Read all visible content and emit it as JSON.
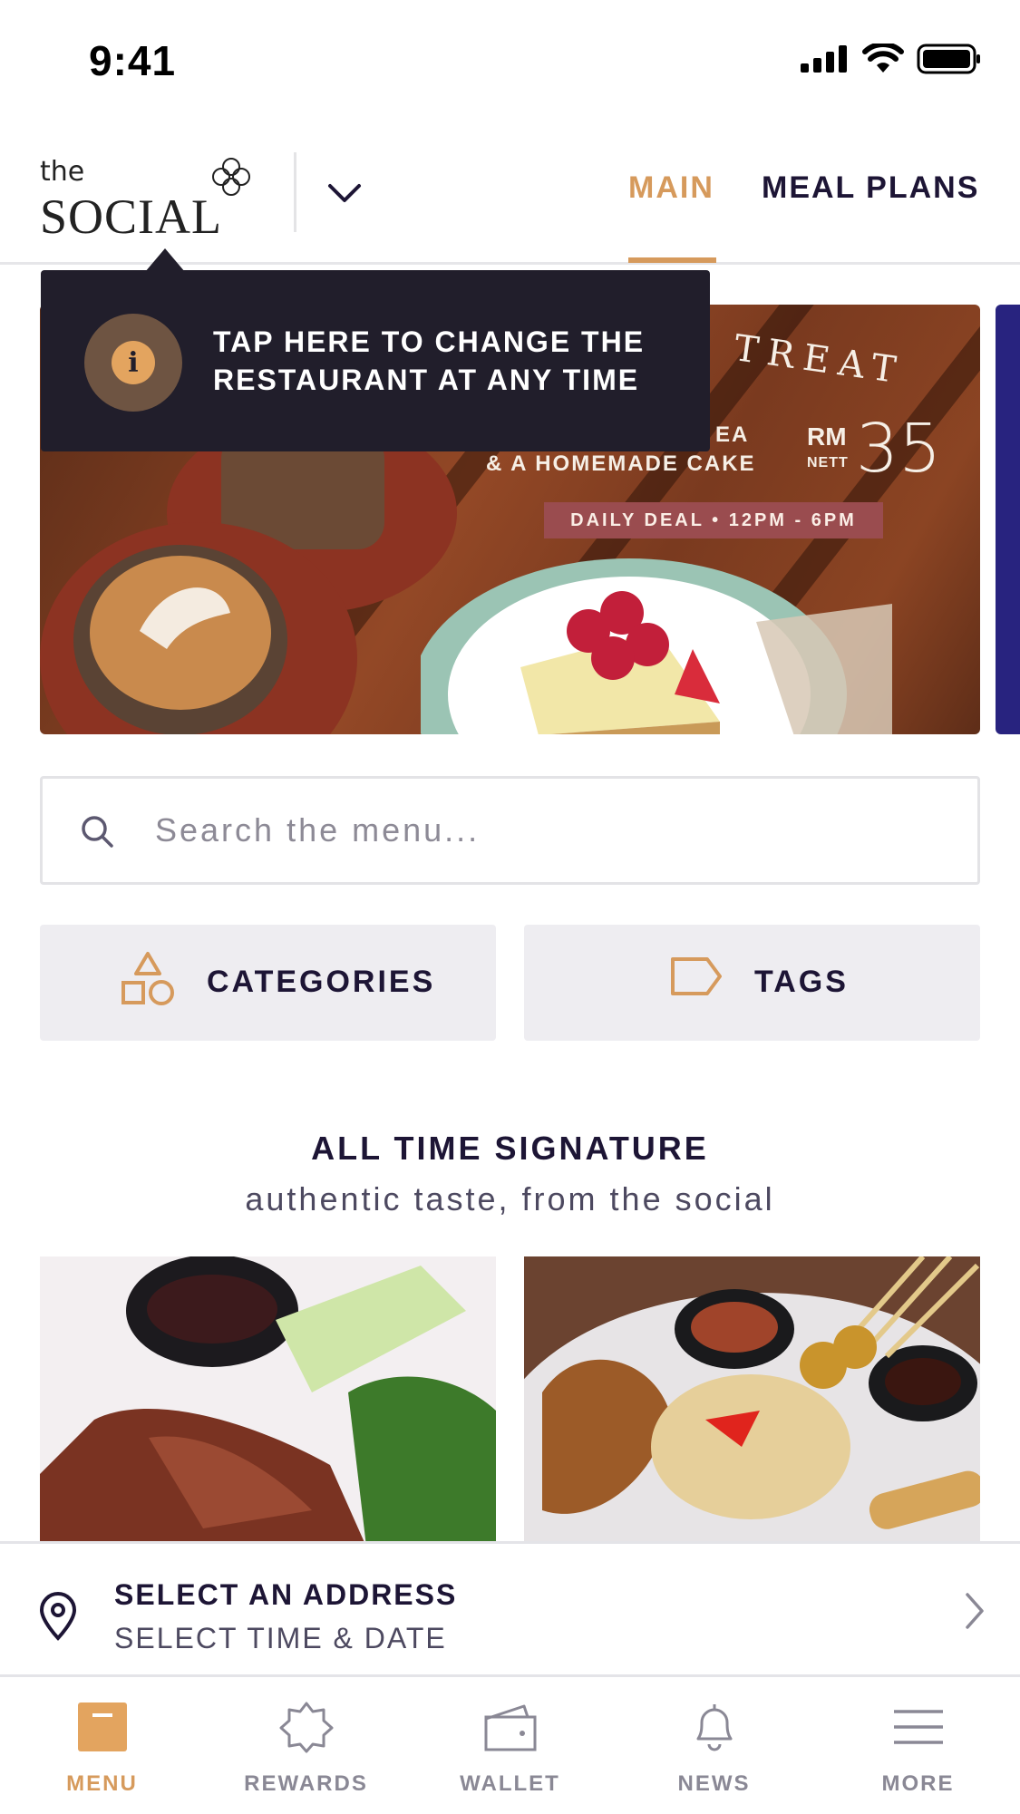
{
  "status_bar": {
    "time": "9:41"
  },
  "header": {
    "logo_the": "the",
    "logo_social": "SOCIAL",
    "tabs": [
      {
        "label": "MAIN",
        "active": true
      },
      {
        "label": "MEAL PLANS",
        "active": false
      }
    ]
  },
  "tooltip": {
    "text": "TAP HERE TO CHANGE THE RESTAURANT AT ANY TIME"
  },
  "banner": {
    "treat": "TREAT",
    "line1": "EA",
    "line2": "& A HOMEMADE CAKE",
    "rm": "RM",
    "nett": "NETT",
    "price": "35",
    "deal": "DAILY DEAL • 12PM - 6PM"
  },
  "search": {
    "placeholder": "Search the menu..."
  },
  "filters": {
    "categories": "CATEGORIES",
    "tags": "TAGS"
  },
  "section": {
    "title": "ALL TIME SIGNATURE",
    "subtitle": "authentic taste, from the social"
  },
  "address": {
    "title": "SELECT AN ADDRESS",
    "subtitle": "SELECT TIME & DATE"
  },
  "bottom_nav": [
    {
      "label": "MENU",
      "icon": "menu-icon",
      "active": true
    },
    {
      "label": "REWARDS",
      "icon": "rewards-icon",
      "active": false
    },
    {
      "label": "WALLET",
      "icon": "wallet-icon",
      "active": false
    },
    {
      "label": "NEWS",
      "icon": "bell-icon",
      "active": false
    },
    {
      "label": "MORE",
      "icon": "hamburger-icon",
      "active": false
    }
  ],
  "colors": {
    "accent": "#d69a5c",
    "navy": "#1d1535",
    "tooltip_bg": "#211e2b",
    "muted": "#8a8895"
  }
}
